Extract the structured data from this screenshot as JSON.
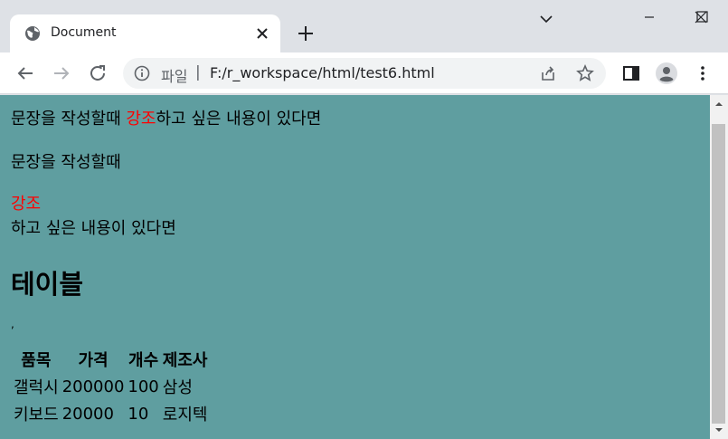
{
  "browser": {
    "tab": {
      "title": "Document",
      "favicon": "globe-icon"
    },
    "address": {
      "scheme_label": "파일",
      "separator": "|",
      "url": "F:/r_workspace/html/test6.html"
    },
    "colors": {
      "frame": "#dee1e6",
      "toolbar": "#ffffff",
      "omnibox": "#f1f3f4"
    }
  },
  "page": {
    "background": "#5f9ea0",
    "line1": {
      "before": "문장을 작성할때 ",
      "emphasis": "강조",
      "after": "하고 싶은 내용이 있다면"
    },
    "block1": "문장을 작성할때",
    "block2": "강조",
    "block3": "하고 싶은 내용이 있다면",
    "heading": "테이블",
    "stray_mark": ",",
    "table": {
      "headers": [
        "품목",
        "가격",
        "개수",
        "제조사"
      ],
      "rows": [
        [
          "갤럭시",
          "200000",
          "100",
          "삼성"
        ],
        [
          "키보드",
          "20000",
          "10",
          "로지텍"
        ]
      ]
    },
    "emphasis_color": "#ff0000"
  }
}
